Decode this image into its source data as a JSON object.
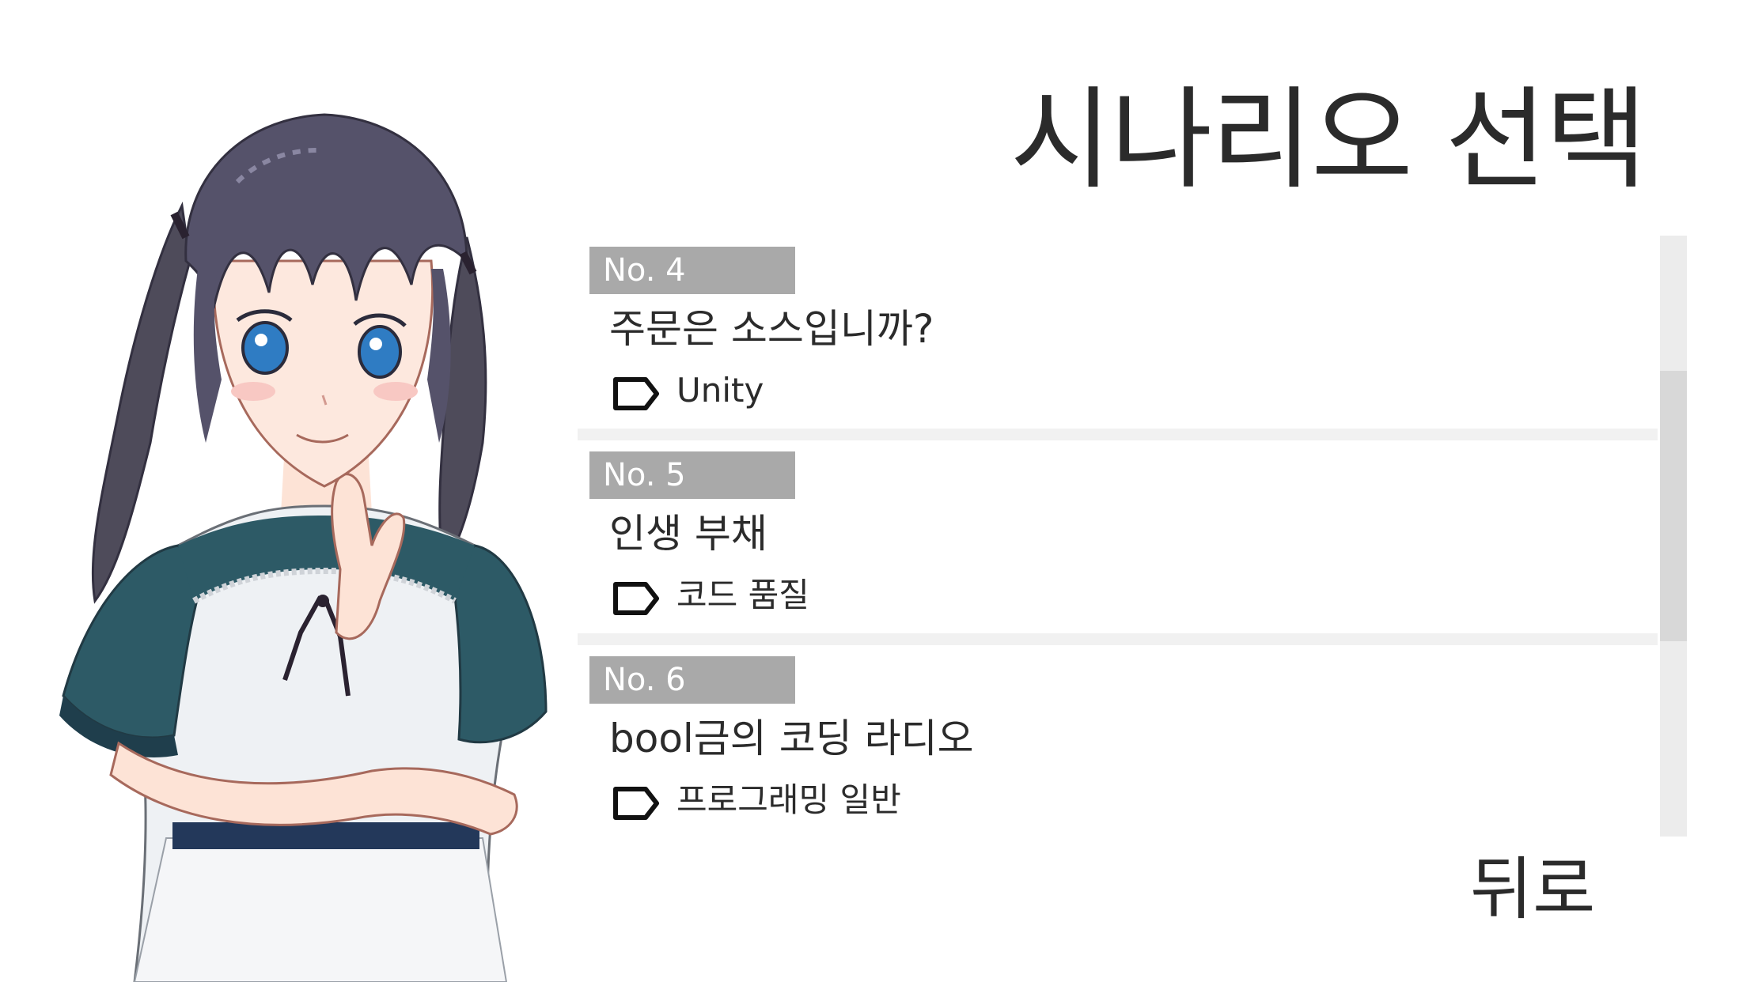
{
  "screen": {
    "title": "시나리오 선택",
    "back_label": "뒤로"
  },
  "scenarios": [
    {
      "number": "No. 4",
      "title": "주문은 소스입니까?",
      "tag_icon": "tag-icon",
      "tag": "Unity"
    },
    {
      "number": "No. 5",
      "title": "인생 부채",
      "tag_icon": "tag-icon",
      "tag": "코드 품질"
    },
    {
      "number": "No. 6",
      "title": "bool금의 코딩 라디오",
      "tag_icon": "tag-icon",
      "tag": "프로그래밍 일반"
    }
  ],
  "scrollbar": {
    "position_fraction": 0.41,
    "visible_fraction": 0.45
  },
  "colors": {
    "badge": "#a9a9a9",
    "divider": "#f1f1f1",
    "text": "#2b2b2b",
    "scroll_track": "#ececec",
    "scroll_thumb": "#d8d8d8"
  }
}
